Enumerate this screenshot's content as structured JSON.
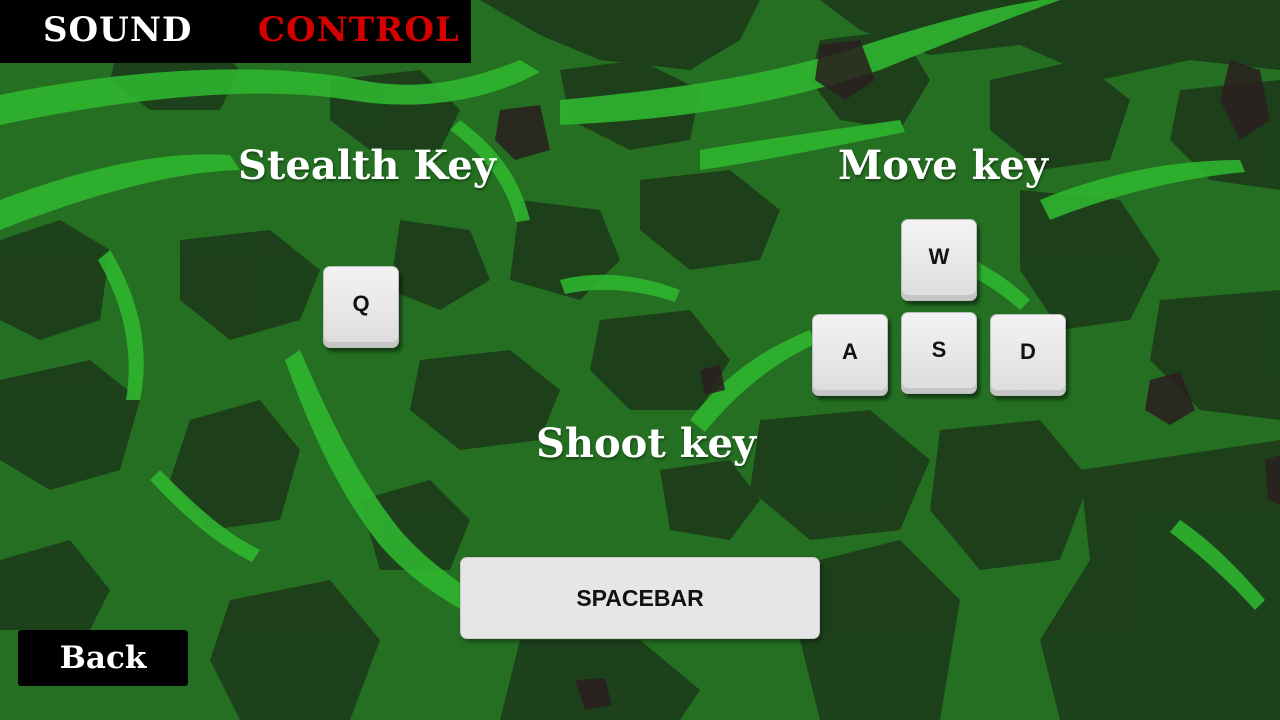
{
  "tabs": {
    "sound_label": "SOUND",
    "control_label": "CONTROL",
    "active": "CONTROL"
  },
  "sections": {
    "stealth_title": "Stealth Key",
    "move_title": "Move key",
    "shoot_title": "Shoot key"
  },
  "keys": {
    "stealth": "Q",
    "move_up": "W",
    "move_left": "A",
    "move_down": "S",
    "move_right": "D",
    "shoot": "SPACEBAR"
  },
  "back_label": "Back",
  "colors": {
    "background_green": "#246f22",
    "camo_dark": "#1d3d1b",
    "camo_bright": "#2fb52f",
    "tab_active": "#d40000",
    "tab_inactive": "#ffffff",
    "panel": "#000000"
  }
}
